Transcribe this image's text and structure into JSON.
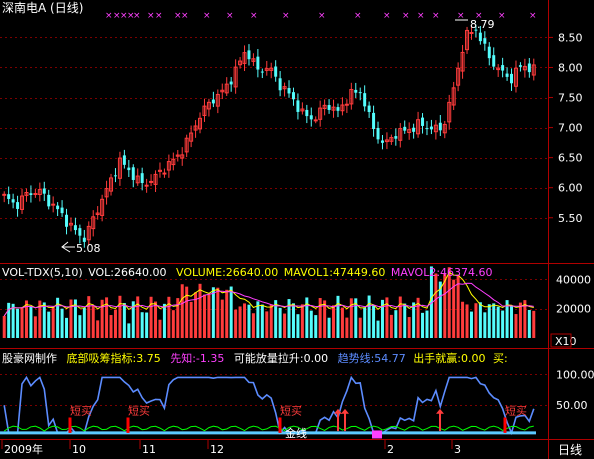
{
  "colors": {
    "up": "#ff3c3c",
    "down": "#54fcfc",
    "grid": "#7a0000",
    "axis": "#b00000",
    "label": "#ffffff"
  },
  "main": {
    "title": "深南电A (日线)",
    "price_ticks": [
      "8.50",
      "8.00",
      "7.50",
      "7.00",
      "6.50",
      "6.00",
      "5.50"
    ],
    "high_label": "8.79",
    "low_label": "5.08"
  },
  "volume": {
    "header": {
      "name": "VOL-TDX(5,10)",
      "vol": "VOL:26640.00",
      "volume": "VOLUME:26640.00",
      "mavol1": "MAVOL1:47449.60",
      "mavol2": "MAVOL2:46374.60"
    },
    "ticks": [
      "40000",
      "20000"
    ],
    "unit": "X10"
  },
  "indicator": {
    "header": {
      "maker": "股豪网制作",
      "bottom": "底部吸筹指标:3.75",
      "xianzhi": "先知:-1.35",
      "fangliang": "可能放量拉升:0.00",
      "trend": "趋势线:54.77",
      "chushou": "出手就赢:0.00",
      "buy": "买:"
    },
    "ticks": [
      "100.00",
      "50.00"
    ],
    "signals": [
      "短买",
      "短买",
      "短买",
      "短买"
    ],
    "jinxian": "金线"
  },
  "xaxis": {
    "labels": [
      "2009年",
      "10",
      "11",
      "12",
      "2",
      "3"
    ],
    "period": "日线"
  },
  "chart_data": {
    "type": "candlestick",
    "title": "深南电A (日线)",
    "ylim": [
      5.1,
      8.9
    ],
    "high": 8.79,
    "low": 5.08,
    "x_labels": [
      "2009年",
      "10",
      "11",
      "12",
      "2",
      "3"
    ],
    "price_close_path": [
      5.85,
      5.7,
      5.9,
      5.95,
      5.75,
      5.55,
      5.3,
      5.15,
      5.6,
      6.0,
      6.45,
      6.25,
      6.05,
      6.15,
      6.35,
      6.5,
      6.8,
      7.2,
      7.45,
      7.6,
      7.9,
      8.3,
      7.95,
      8.0,
      7.7,
      7.5,
      7.2,
      7.15,
      7.4,
      7.25,
      7.55,
      7.6,
      7.0,
      6.7,
      6.9,
      6.95,
      7.05,
      7.0,
      6.95,
      7.6,
      8.5,
      8.65,
      8.2,
      7.95,
      7.8,
      8.05,
      7.95
    ],
    "volume_series": [
      {
        "name": "VOL",
        "last": 26640.0
      },
      {
        "name": "MAVOL1",
        "last": 47449.6
      },
      {
        "name": "MAVOL2",
        "last": 46374.6
      }
    ],
    "volume_ylim": [
      0,
      45000
    ],
    "indicator_ylim": [
      0,
      120
    ]
  }
}
